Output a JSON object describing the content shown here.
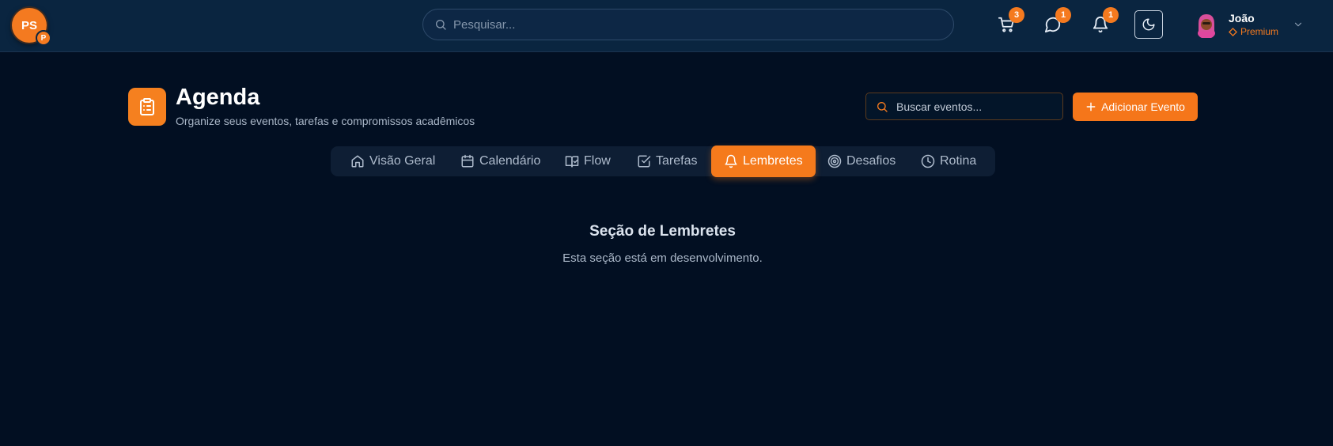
{
  "header": {
    "logo_text": "PS",
    "logo_badge": "P",
    "search_placeholder": "Pesquisar...",
    "cart_count": "3",
    "messages_count": "1",
    "notifications_count": "1",
    "user": {
      "name": "João",
      "plan": "Premium"
    }
  },
  "page": {
    "title": "Agenda",
    "subtitle": "Organize seus eventos, tarefas e compromissos acadêmicos",
    "search_placeholder": "Buscar eventos...",
    "add_button": "Adicionar Evento"
  },
  "tabs": [
    {
      "label": "Visão Geral",
      "icon": "home-icon"
    },
    {
      "label": "Calendário",
      "icon": "calendar-icon"
    },
    {
      "label": "Flow",
      "icon": "book-check-icon"
    },
    {
      "label": "Tarefas",
      "icon": "checkbox-icon"
    },
    {
      "label": "Lembretes",
      "icon": "bell-icon",
      "active": true
    },
    {
      "label": "Desafios",
      "icon": "target-icon"
    },
    {
      "label": "Rotina",
      "icon": "clock-icon"
    }
  ],
  "content": {
    "title": "Seção de Lembretes",
    "description": "Esta seção está em desenvolvimento."
  },
  "colors": {
    "accent": "#f57a1f",
    "background": "#020f22",
    "topbar": "#0a2540"
  }
}
